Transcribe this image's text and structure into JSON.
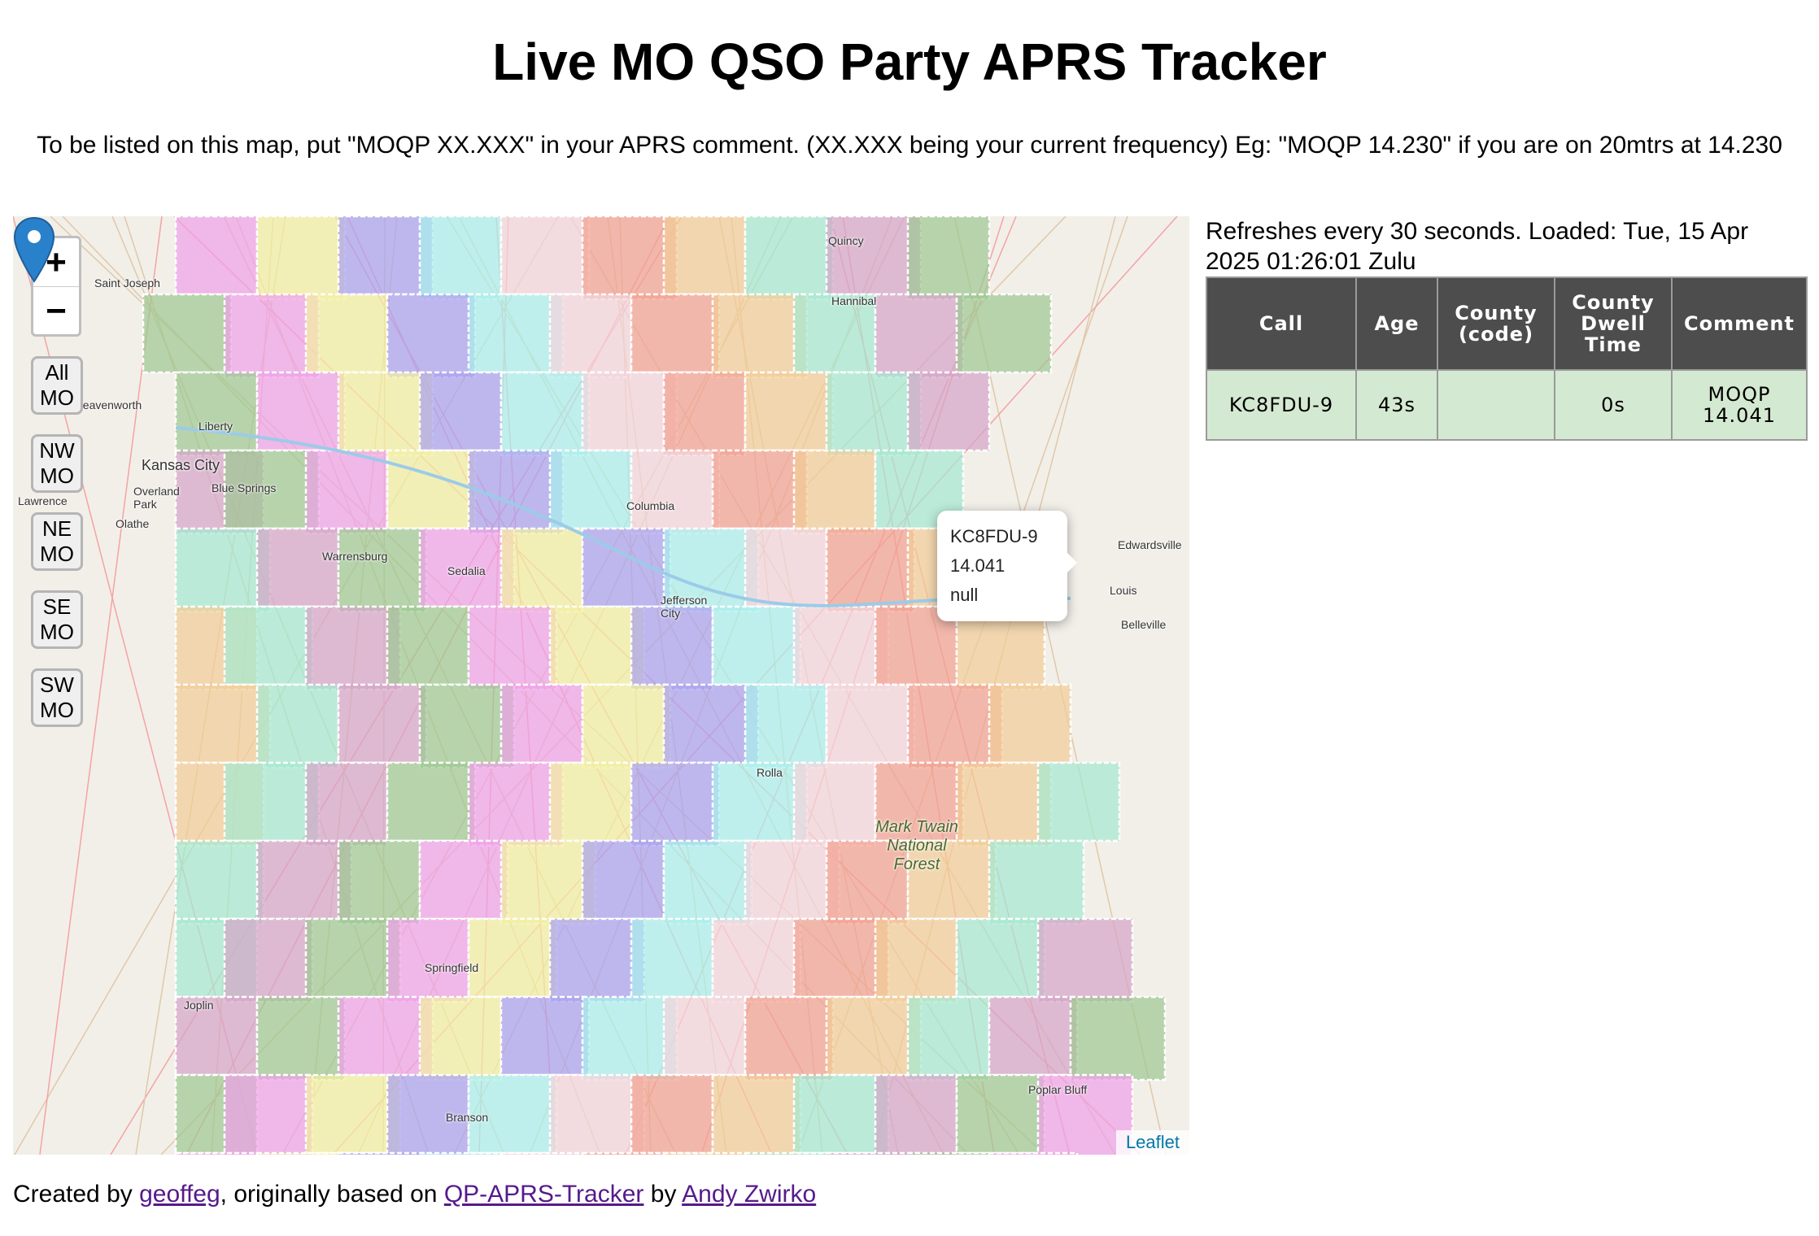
{
  "page": {
    "title": "Live MO QSO Party APRS Tracker",
    "intro": "To be listed on this map, put \"MOQP XX.XXX\" in your APRS comment. (XX.XXX being your current frequency) Eg: \"MOQP 14.230\" if you are on 20mtrs at 14.230"
  },
  "map": {
    "zoom_in": "+",
    "zoom_out": "−",
    "region_buttons": [
      {
        "line1": "All",
        "line2": "MO"
      },
      {
        "line1": "NW",
        "line2": "MO"
      },
      {
        "line1": "NE",
        "line2": "MO"
      },
      {
        "line1": "SE",
        "line2": "MO"
      },
      {
        "line1": "SW",
        "line2": "MO"
      }
    ],
    "popup": {
      "call": "KC8FDU-9",
      "freq": "14.041",
      "info": "null"
    },
    "attribution": "Leaflet",
    "places": {
      "saint_joseph": "Saint Joseph",
      "leavenworth": "Leavenworth",
      "liberty": "Liberty",
      "kansas_city": "Kansas City",
      "blue_springs": "Blue Springs",
      "overland_park": "Overland Park",
      "lawrence": "Lawrence",
      "olathe": "Olathe",
      "warrensburg": "Warrensburg",
      "sedalia": "Sedalia",
      "columbia": "Columbia",
      "jefferson_city": "Jefferson City",
      "quincy": "Quincy",
      "hannibal": "Hannibal",
      "edwardsville": "Edwardsville",
      "st_louis": "Louis",
      "belleville": "Belleville",
      "rolla": "Rolla",
      "mark_twain": "Mark Twain National Forest",
      "springfield": "Springfield",
      "joplin": "Joplin",
      "branson": "Branson",
      "poplar_bluff": "Poplar Bluff"
    },
    "colors": {
      "pink": "#f0a0e8",
      "cyan": "#a8f0ec",
      "tan": "#f2cc96",
      "green": "#9cc890",
      "purple": "#a8a0f0",
      "salmon": "#f2a090",
      "mauve": "#d4a4c8",
      "yellow": "#f2f0a0",
      "rose": "#f4d4dc",
      "teal": "#a4e8d0"
    }
  },
  "status": {
    "refresh_text": "Refreshes every 30 seconds. Loaded: Tue, 15 Apr 2025 01:26:01 Zulu"
  },
  "table": {
    "headers": {
      "call": "Call",
      "age": "Age",
      "county_l1": "County",
      "county_l2": "(code)",
      "dwell_l1": "County",
      "dwell_l2": "Dwell",
      "dwell_l3": "Time",
      "comment": "Comment"
    },
    "rows": [
      {
        "call": "KC8FDU-9",
        "age": "43s",
        "county": "",
        "dwell": "0s",
        "comment_l1": "MOQP",
        "comment_l2": "14.041"
      }
    ]
  },
  "footer": {
    "prefix": "Created by ",
    "author_link": "geoffeg",
    "middle": ", originally based on ",
    "project_link": "QP-APRS-Tracker",
    "by": " by ",
    "original_author_link": "Andy Zwirko"
  }
}
